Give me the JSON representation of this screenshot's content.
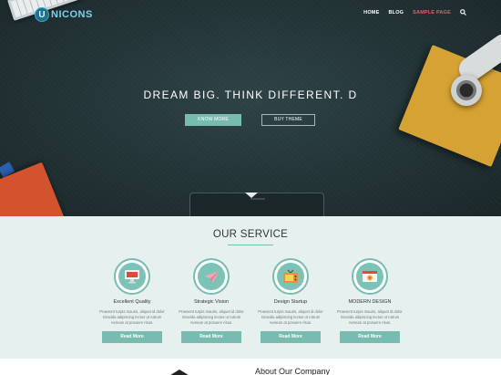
{
  "header": {
    "logo_letter": "U",
    "logo_text": "NICONS",
    "nav": [
      "HOME",
      "BLOG",
      "SAMPLE PAGE"
    ],
    "active_nav": "SAMPLE PAGE",
    "search_icon": "search-icon"
  },
  "hero": {
    "title": "DREAM BIG. THINK DIFFERENT. D",
    "know_more": "KNOW MORE",
    "buy_theme": "BUY THEME"
  },
  "services": {
    "title": "OUR SERVICE",
    "items": [
      {
        "title": "Excellent Quality",
        "icon": "monitor-icon",
        "desc": "Praesent turpis mauris, aliquet id dolor Gravida adipiscing lectus ut rutrum Aenean at posuere risus.",
        "button": "Read More"
      },
      {
        "title": "Strategic Vision",
        "icon": "paper-plane-icon",
        "desc": "Praesent turpis mauris, aliquet id dolor Gravida adipiscing lectus ut rutrum Aenean at posuere risus.",
        "button": "Read More"
      },
      {
        "title": "Design Startup",
        "icon": "tv-icon",
        "desc": "Praesent turpis mauris, aliquet id dolor Gravida adipiscing lectus ut rutrum Aenean at posuere risus.",
        "button": "Read More"
      },
      {
        "title": "MODERN DESIGN",
        "icon": "browser-design-icon",
        "desc": "Praesent turpis mauris, aliquet id dolor Gravida adipiscing lectus ut rutrum Aenean at posuere risus.",
        "button": "Read More"
      }
    ]
  },
  "about": {
    "title": "About Our Company"
  },
  "colors": {
    "accent": "#78bcb1",
    "active_nav": "#ef5a6a",
    "services_bg": "#e6f0ef",
    "hero_bg": "#243639"
  }
}
